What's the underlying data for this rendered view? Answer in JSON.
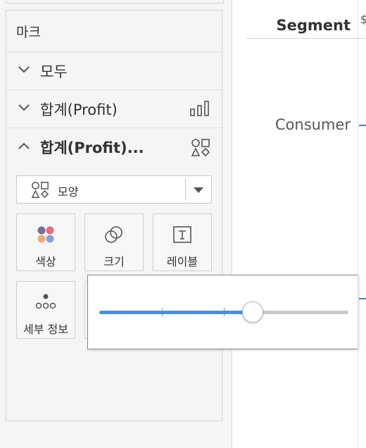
{
  "marks": {
    "title": "마크",
    "rows": [
      {
        "label": "모두",
        "state": "collapsed"
      },
      {
        "label": "합계(Profit)",
        "state": "collapsed",
        "icon": "bar-chart-icon"
      },
      {
        "label": "합계(Profit)...",
        "state": "expanded",
        "icon": "shapes-icon"
      }
    ],
    "mark_type": {
      "label": "모양",
      "icon": "shapes-icon"
    },
    "tiles": [
      {
        "label": "색상",
        "icon": "color-dots-icon"
      },
      {
        "label": "크기",
        "icon": "size-circles-icon"
      },
      {
        "label": "레이블",
        "icon": "text-label-icon"
      },
      {
        "label": "세부 정보",
        "icon": "detail-dots-icon"
      }
    ]
  },
  "size_slider": {
    "value": 0.615,
    "ticks": [
      0.25,
      0.5
    ]
  },
  "view": {
    "column_header": "Segment",
    "partial_header": "$",
    "row_label": "Consumer"
  },
  "colors": {
    "accent": "#4a90e2",
    "dot_purple": "#7b6a9a",
    "dot_pink": "#ee6a7a",
    "dot_orange": "#f2a97a",
    "dot_blue": "#7fa7d6"
  }
}
